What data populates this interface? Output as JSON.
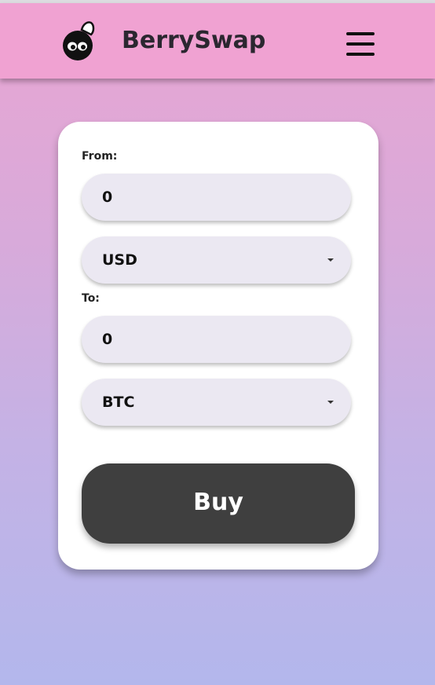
{
  "app": {
    "brand": "BerrySwap",
    "logo_icon": "berry-bomb-icon",
    "menu_icon": "hamburger-menu-icon"
  },
  "colors": {
    "header": "#f0a2d2",
    "field_bg": "#ebe8f2",
    "button_bg": "#3f3f3f",
    "brand_text": "#2b2730"
  },
  "form": {
    "from_label": "From:",
    "from_amount": "0",
    "from_currency": "USD",
    "to_label": "To:",
    "to_amount": "0",
    "to_currency": "BTC",
    "buy_label": "Buy"
  }
}
